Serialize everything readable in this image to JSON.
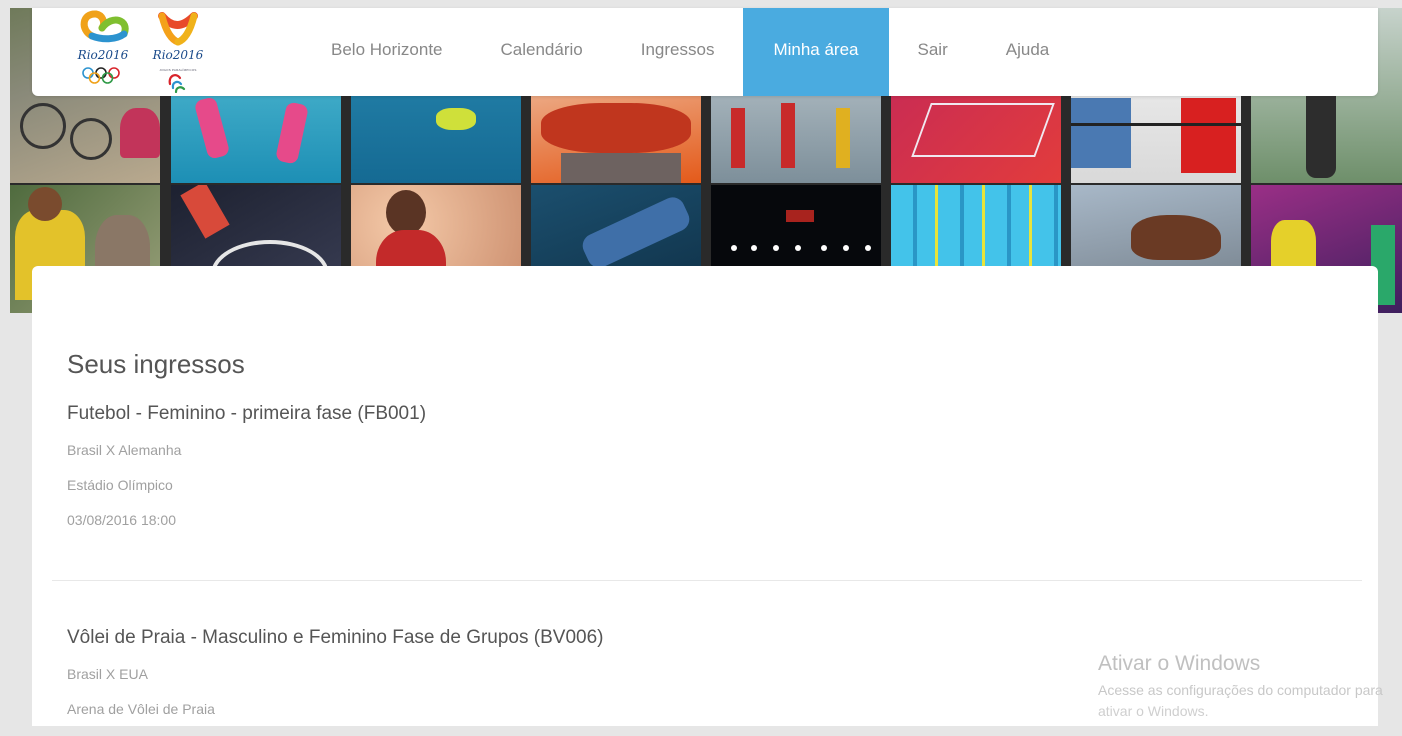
{
  "header": {
    "logo_olympic_text": "Rio2016",
    "logo_para_text": "Rio2016",
    "logo_para_subtext": "JOGOS PARALÍMPICOS"
  },
  "nav": {
    "items": [
      {
        "label": "Belo Horizonte",
        "name": "nav-belo-horizonte"
      },
      {
        "label": "Calendário",
        "name": "nav-calendario"
      },
      {
        "label": "Ingressos",
        "name": "nav-ingressos"
      },
      {
        "label": "Minha área",
        "name": "nav-minha-area",
        "active": true
      },
      {
        "label": "Sair",
        "name": "nav-sair"
      },
      {
        "label": "Ajuda",
        "name": "nav-ajuda"
      }
    ],
    "active_color": "#4aabe0"
  },
  "main": {
    "section_title": "Seus ingressos",
    "tickets": [
      {
        "title": "Futebol - Feminino - primeira fase (FB001)",
        "match": "Brasil X Alemanha",
        "venue": "Estádio Olímpico",
        "datetime": "03/08/2016 18:00"
      },
      {
        "title": "Vôlei de Praia - Masculino e Feminino Fase de Grupos (BV006)",
        "match": "Brasil X EUA",
        "venue": "Arena de Vôlei de Praia"
      }
    ]
  },
  "watermark": {
    "title": "Ativar o Windows",
    "subtitle": "Acesse as configurações do computador para",
    "subtitle2": "ativar o Windows."
  }
}
